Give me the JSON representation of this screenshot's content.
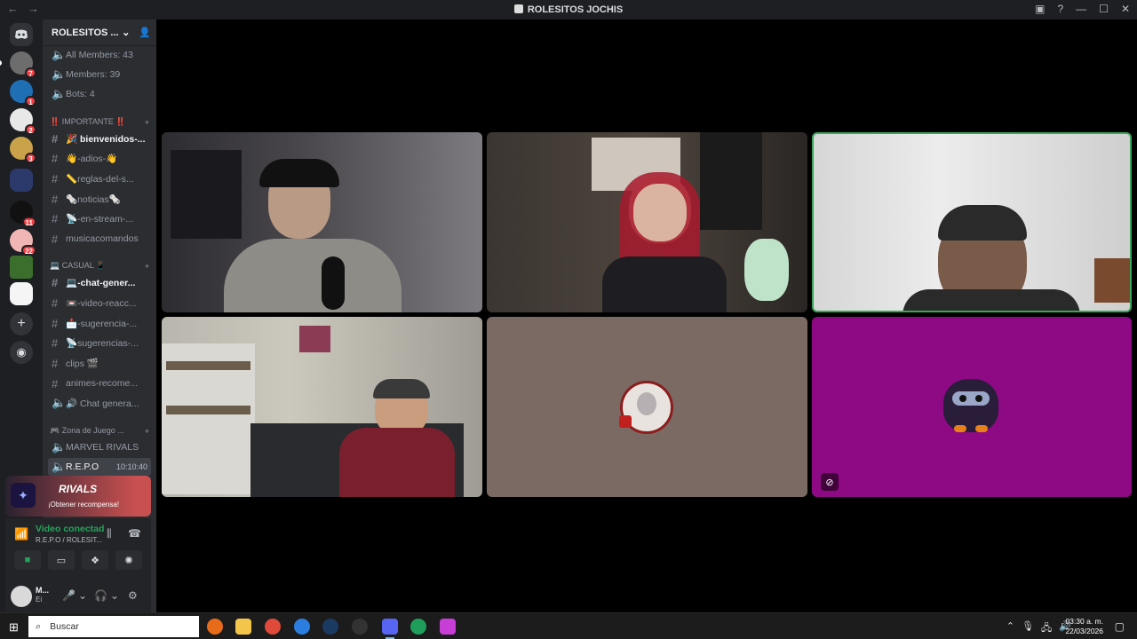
{
  "window": {
    "title": "ROLESITOS JOCHIS"
  },
  "server": {
    "name": "ROLESITOS ...",
    "stats": [
      "All Members: 43",
      "Members: 39",
      "Bots: 4"
    ],
    "categories": [
      {
        "label": "‼️ IMPORTANTE ‼️"
      },
      {
        "label": "💻 CASUAL 📱"
      },
      {
        "label": "🎮 Zona de Juego ..."
      }
    ],
    "channels": [
      {
        "label": "🎉 bienvenidos-..."
      },
      {
        "label": "👋-adios-👋"
      },
      {
        "label": "📏reglas-del-s..."
      },
      {
        "label": "🗞️noticias🗞️"
      },
      {
        "label": "📡-en-stream-..."
      },
      {
        "label": "musicacomandos"
      },
      {
        "label": "💻-chat-gener..."
      },
      {
        "label": "📼-video-reacc..."
      },
      {
        "label": "📩-sugerencia-..."
      },
      {
        "label": "📡sugerencias-..."
      },
      {
        "label": "clips 🎬"
      },
      {
        "label": "animes-recome..."
      },
      {
        "label": "🔊 Chat genera..."
      }
    ],
    "voice_channels": [
      {
        "label": "MARVEL RIVALS"
      },
      {
        "label": "R.E.P.O",
        "time": "10:10:40"
      }
    ]
  },
  "guild_badges": [
    "7",
    "1",
    "2",
    "3",
    "11",
    "22"
  ],
  "promo": {
    "brand": "RIVALS",
    "cta": "¡Obtener recompensa!"
  },
  "voice": {
    "status": "Video conectad",
    "sub": "R.E.P.O / ROLESIT..."
  },
  "user": {
    "name": "M...",
    "status": "Ei"
  },
  "taskbar": {
    "search": "Buscar",
    "time": "03:30 a. m.",
    "date": "22/03/2026"
  },
  "colors": {
    "speaking": "#3ba55c",
    "tile_brown": "#7b6a64",
    "tile_magenta": "#8e0a84"
  }
}
